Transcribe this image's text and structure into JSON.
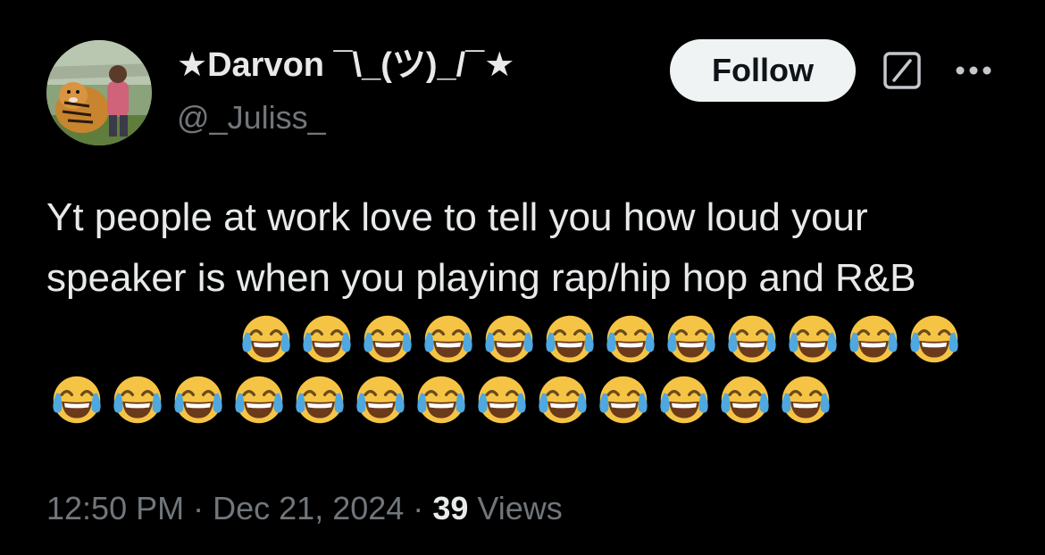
{
  "author": {
    "display_name": "★Darvon ¯\\_(ツ)_/¯★",
    "handle": "@_Juliss_",
    "avatar_icon": "profile-photo-with-tiger"
  },
  "actions": {
    "follow_label": "Follow",
    "grok_icon": "slash-box-icon",
    "more_icon": "more-dots-icon"
  },
  "tweet": {
    "text": "Yt people at work love to tell you how loud your speaker is when you playing rap/hip hop and R&B",
    "emoji": "😂",
    "emoji_count": 25
  },
  "meta": {
    "time": "12:50 PM",
    "separator": "·",
    "date": "Dec 21, 2024",
    "views_count": "39",
    "views_label": "Views"
  },
  "colors": {
    "background": "#000000",
    "primary_text": "#e7e9ea",
    "secondary_text": "#71767b",
    "follow_bg": "#eff3f4"
  }
}
